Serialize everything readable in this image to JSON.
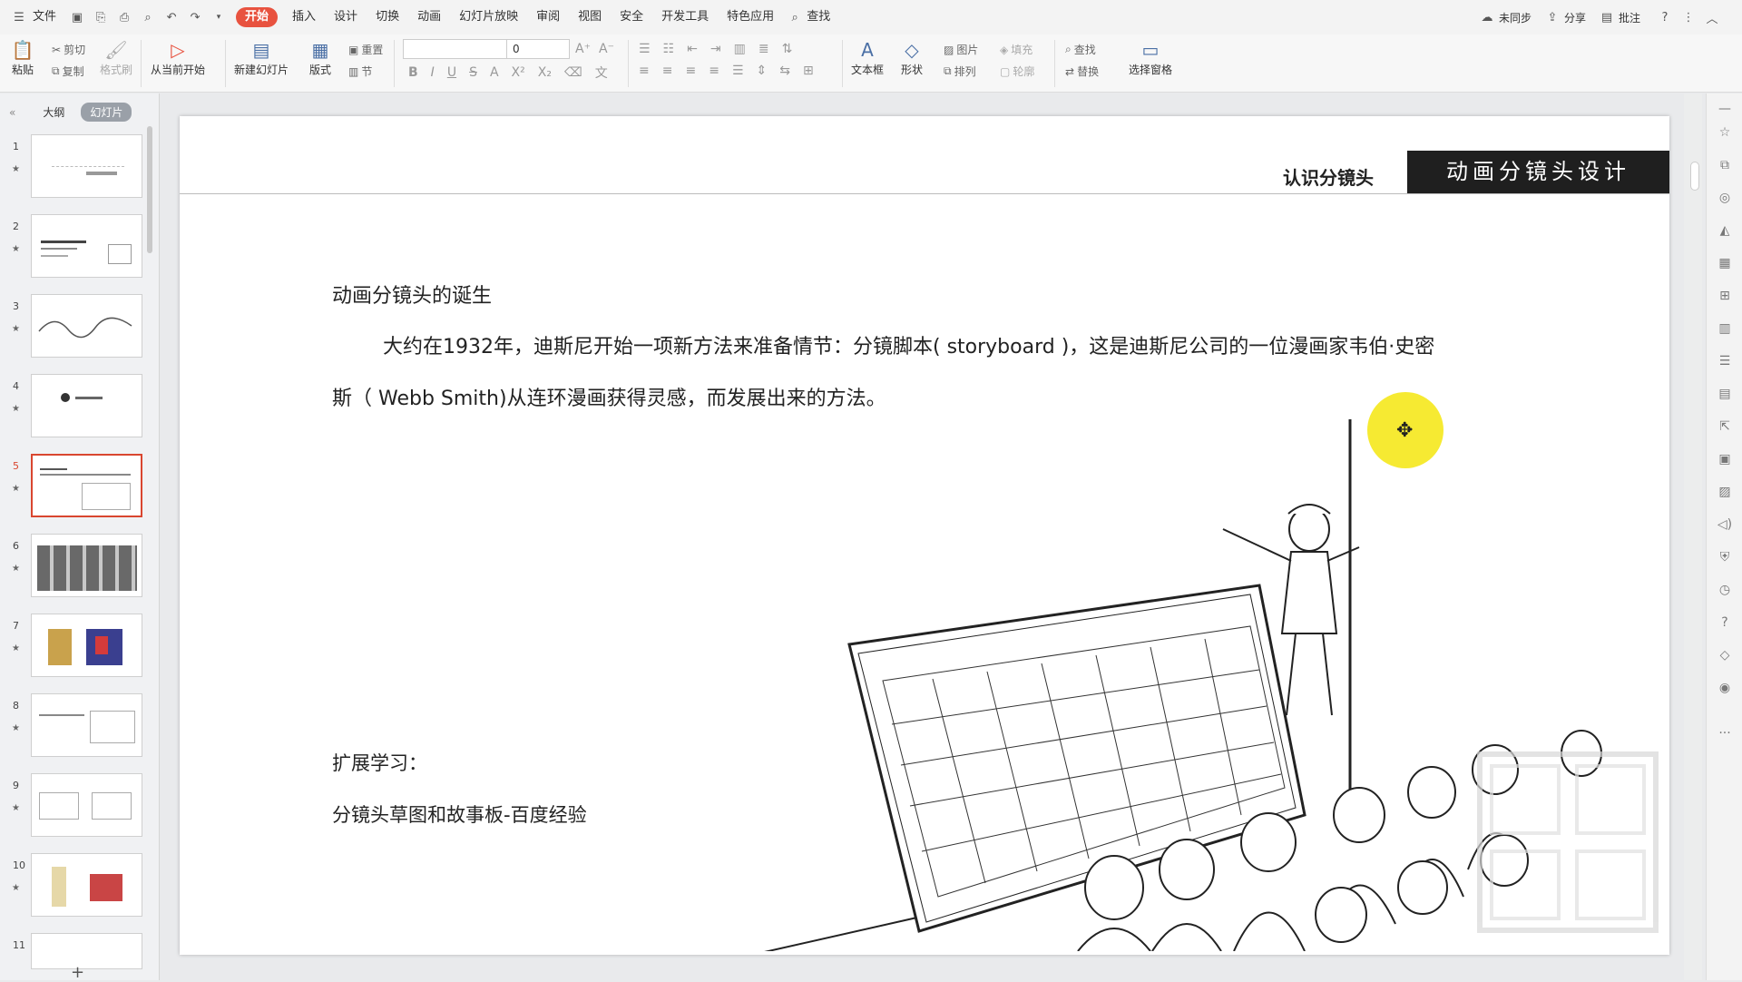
{
  "menu": {
    "file": "文件",
    "tabs": [
      "开始",
      "插入",
      "设计",
      "切换",
      "动画",
      "幻灯片放映",
      "审阅",
      "视图",
      "安全",
      "开发工具",
      "特色应用"
    ],
    "active_tab": "开始",
    "search": "查找",
    "right": {
      "sync": "未同步",
      "share": "分享",
      "comment": "批注"
    }
  },
  "ribbon": {
    "paste": "粘贴",
    "cut": "剪切",
    "copy": "复制",
    "format_painter": "格式刷",
    "from_current": "从当前开始",
    "new_slide": "新建幻灯片",
    "layout": "版式",
    "reset": "重置",
    "section": "节",
    "font_name": "",
    "font_size": "0",
    "textbox": "文本框",
    "shape": "形状",
    "picture": "图片",
    "fill": "填充",
    "arrange": "排列",
    "outline": "轮廓",
    "find": "查找",
    "replace": "替换",
    "select_pane": "选择窗格"
  },
  "panel": {
    "tab_outline": "大纲",
    "tab_slides": "幻灯片",
    "slides": [
      "1",
      "2",
      "3",
      "4",
      "5",
      "6",
      "7",
      "8",
      "9",
      "10",
      "11"
    ],
    "selected": "5"
  },
  "slide": {
    "header_left": "认识分镜头",
    "header_right": "动画分镜头设计",
    "heading": "动画分镜头的诞生",
    "para1": "大约在1932年，迪斯尼开始一项新方法来准备情节：分镜脚本( storyboard )，这是迪斯尼公司的一位漫画家韦伯·史密",
    "para2": "斯（ Webb Smith)从连环漫画获得灵感，而发展出来的方法。",
    "ext_title": "扩展学习：",
    "ext_link": "分镜头草图和故事板-百度经验"
  },
  "colors": {
    "accent": "#e8523f",
    "header_dark": "#1f1f1f",
    "cursor_highlight": "#f5e81c"
  }
}
